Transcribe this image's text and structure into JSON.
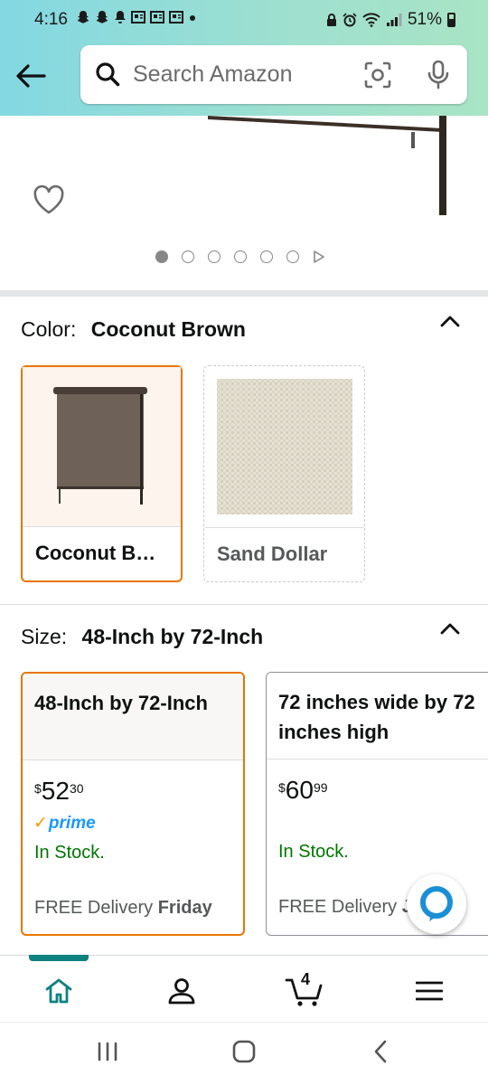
{
  "status_bar": {
    "time": "4:16",
    "battery": "51%"
  },
  "search": {
    "placeholder": "Search Amazon"
  },
  "product_images": {
    "dot_count": 6,
    "active_index": 0
  },
  "color": {
    "label": "Color:",
    "selected": "Coconut Brown",
    "options": [
      {
        "label": "Coconut B…",
        "selected": true
      },
      {
        "label": "Sand Dollar",
        "selected": false
      }
    ]
  },
  "size": {
    "label": "Size:",
    "selected": "48-Inch by 72-Inch",
    "options": [
      {
        "name": "48-Inch by 72-Inch",
        "price_currency": "$",
        "price_whole": "52",
        "price_fraction": "30",
        "prime": "prime",
        "stock": "In Stock.",
        "delivery_prefix": "FREE Delivery ",
        "delivery_day": "Friday"
      },
      {
        "name": "72 inches wide by 72\ninches high",
        "price_currency": "$",
        "price_whole": "60",
        "price_fraction": "99",
        "stock": "In Stock.",
        "delivery_prefix": "FREE Delivery ",
        "delivery_day": "July"
      }
    ]
  },
  "bottom_nav": {
    "cart_count": "4",
    "active": "home"
  },
  "colors": {
    "header_start": "#83d8e2",
    "header_end": "#a8e4c5",
    "selected_border": "#e77600",
    "stock_green": "#007600",
    "prime_blue": "#1a98ff",
    "nav_accent": "#108181"
  }
}
